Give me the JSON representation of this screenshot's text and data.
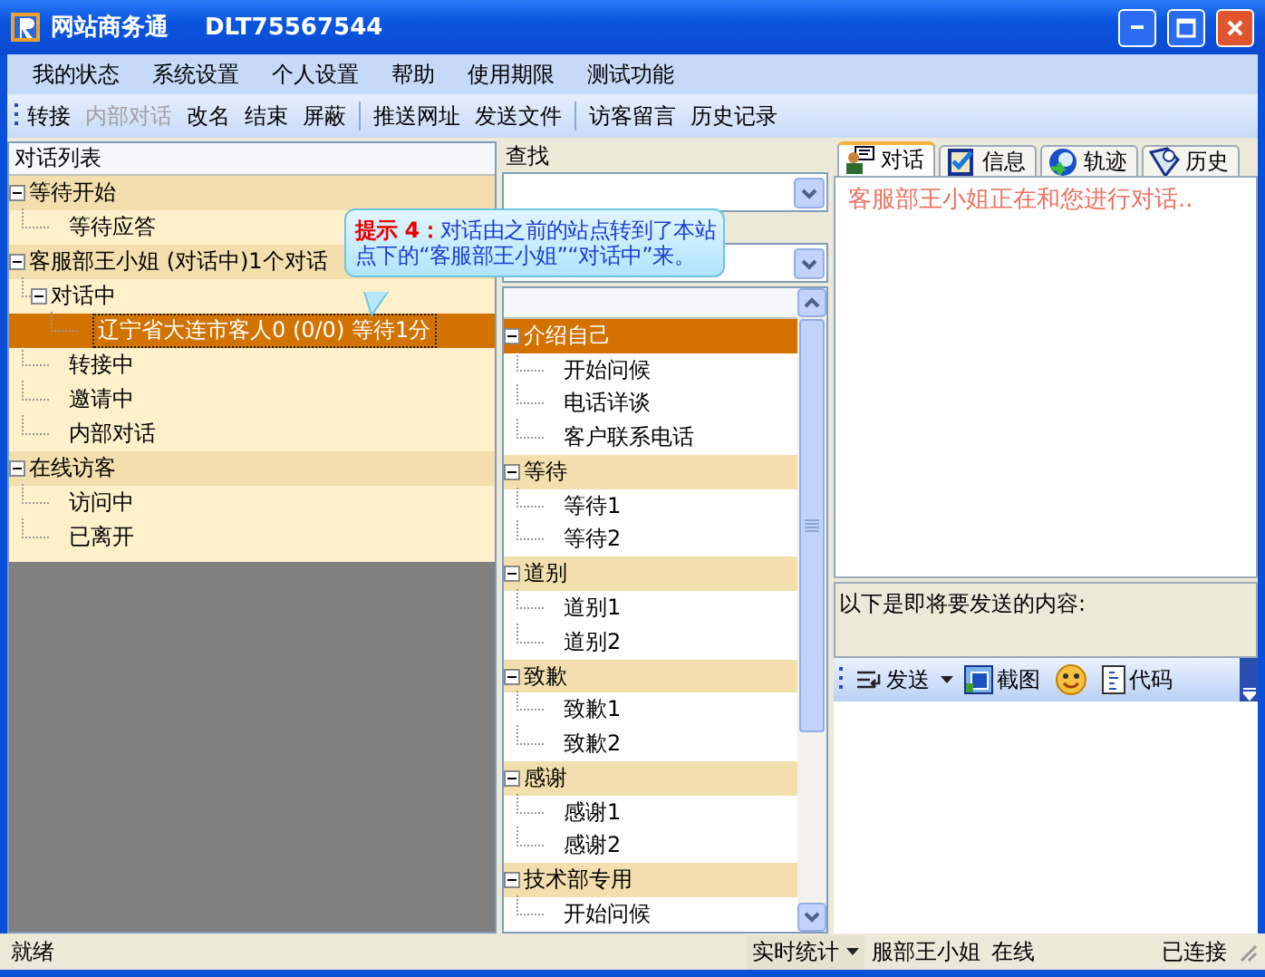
{
  "window": {
    "title": "网站商务通",
    "account": "DLT75567544"
  },
  "menu": [
    "我的状态",
    "系统设置",
    "个人设置",
    "帮助",
    "使用期限",
    "测试功能"
  ],
  "toolbar": {
    "groups": [
      [
        {
          "label": "转接",
          "disabled": false
        },
        {
          "label": "内部对话",
          "disabled": true
        },
        {
          "label": "改名",
          "disabled": false
        },
        {
          "label": "结束",
          "disabled": false
        },
        {
          "label": "屏蔽",
          "disabled": false
        }
      ],
      [
        {
          "label": "推送网址",
          "disabled": false
        },
        {
          "label": "发送文件",
          "disabled": false
        }
      ],
      [
        {
          "label": "访客留言",
          "disabled": false
        },
        {
          "label": "历史记录",
          "disabled": false
        }
      ]
    ]
  },
  "conversation_list": {
    "title": "对话列表",
    "items": [
      {
        "label": "等待开始",
        "expanded": true,
        "selected": false,
        "children": [
          {
            "label": "等待应答",
            "selected": false
          }
        ]
      },
      {
        "label": "客服部王小姐 (对话中)1个对话",
        "expanded": true,
        "selected": false,
        "children": [
          {
            "label": "对话中",
            "expanded": true,
            "selected": false,
            "children": [
              {
                "label": "辽宁省大连市客人0 (0/0) 等待1分",
                "selected": true
              }
            ]
          },
          {
            "label": "转接中",
            "selected": false
          },
          {
            "label": "邀请中",
            "selected": false
          },
          {
            "label": "内部对话",
            "selected": false
          }
        ]
      },
      {
        "label": "在线访客",
        "expanded": true,
        "selected": false,
        "children": [
          {
            "label": "访问中",
            "selected": false
          },
          {
            "label": "已离开",
            "selected": false
          }
        ]
      }
    ]
  },
  "search": {
    "label": "查找"
  },
  "quick_replies": {
    "items": [
      {
        "label": "介绍自己",
        "expanded": true,
        "selected": true,
        "children": [
          {
            "label": "开始问候",
            "selected": false
          },
          {
            "label": "电话详谈",
            "selected": false
          },
          {
            "label": "客户联系电话",
            "selected": false
          }
        ]
      },
      {
        "label": "等待",
        "expanded": true,
        "selected": false,
        "children": [
          {
            "label": "等待1",
            "selected": false
          },
          {
            "label": "等待2",
            "selected": false
          }
        ]
      },
      {
        "label": "道别",
        "expanded": true,
        "selected": false,
        "children": [
          {
            "label": "道别1",
            "selected": false
          },
          {
            "label": "道别2",
            "selected": false
          }
        ]
      },
      {
        "label": "致歉",
        "expanded": true,
        "selected": false,
        "children": [
          {
            "label": "致歉1",
            "selected": false
          },
          {
            "label": "致歉2",
            "selected": false
          }
        ]
      },
      {
        "label": "感谢",
        "expanded": true,
        "selected": false,
        "children": [
          {
            "label": "感谢1",
            "selected": false
          },
          {
            "label": "感谢2",
            "selected": false
          }
        ]
      },
      {
        "label": "技术部专用",
        "expanded": true,
        "selected": false,
        "children": [
          {
            "label": "开始问候",
            "selected": false
          }
        ]
      }
    ]
  },
  "tabs": [
    {
      "kind": "chat",
      "label": "对话",
      "selected": true
    },
    {
      "kind": "info",
      "label": "信息",
      "selected": false
    },
    {
      "kind": "track",
      "label": "轨迹",
      "selected": false
    },
    {
      "kind": "history",
      "label": "历史",
      "selected": false
    }
  ],
  "chat": {
    "message": "客服部王小姐正在和您进行对话.."
  },
  "compose": {
    "label": "以下是即将要发送的内容:",
    "tools": [
      {
        "kind": "send",
        "label": "发送"
      },
      {
        "kind": "capture",
        "label": "截图"
      },
      {
        "kind": "emoji"
      },
      {
        "kind": "code",
        "label": "代码"
      }
    ]
  },
  "tooltip": {
    "text": "**提示 4：**对话由之前的站点转到了本站点下的“客服部王小姐”“对话中”来。"
  },
  "status_bar": {
    "text": "就绪",
    "stats_button": "实时统计",
    "agent": "服部王小姐",
    "presence": "在线",
    "connection": "已连接"
  }
}
